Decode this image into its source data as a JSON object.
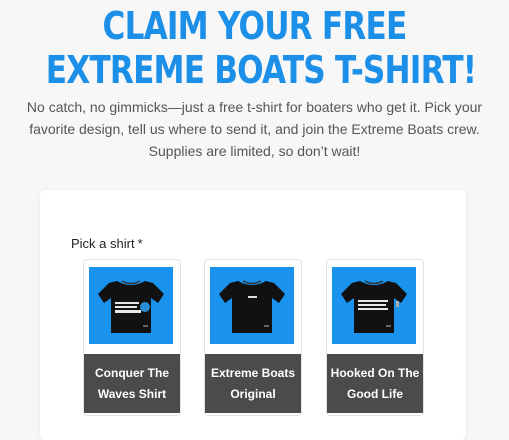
{
  "hero": {
    "title_line1": "CLAIM YOUR FREE",
    "title_line2": "EXTREME BOATS T-SHIRT!"
  },
  "intro": {
    "text": "No catch, no gimmicks—just a free t-shirt for boaters who get it. Pick your favorite design, tell us where to send it, and join the Extreme Boats crew. Supplies are limited, so don’t wait!"
  },
  "form": {
    "shirt_label": "Pick a shirt",
    "required_marker": "*",
    "shirts": [
      {
        "name": "Conquer The Waves Shirt",
        "image_bg": "#1a93ee",
        "print_text": "CONQUER THE WAVES"
      },
      {
        "name": "Extreme Boats Original",
        "image_bg": "#1a93ee",
        "print_text": "EXTREME"
      },
      {
        "name": "Hooked On The Good Life",
        "image_bg": "#1a93ee",
        "print_text": "HOOKED ON THE GOOD LIFE"
      }
    ]
  },
  "colors": {
    "accent": "#1c8fe8",
    "caption_bg": "#4b4b4b",
    "page_bg": "#f7f7f7"
  }
}
